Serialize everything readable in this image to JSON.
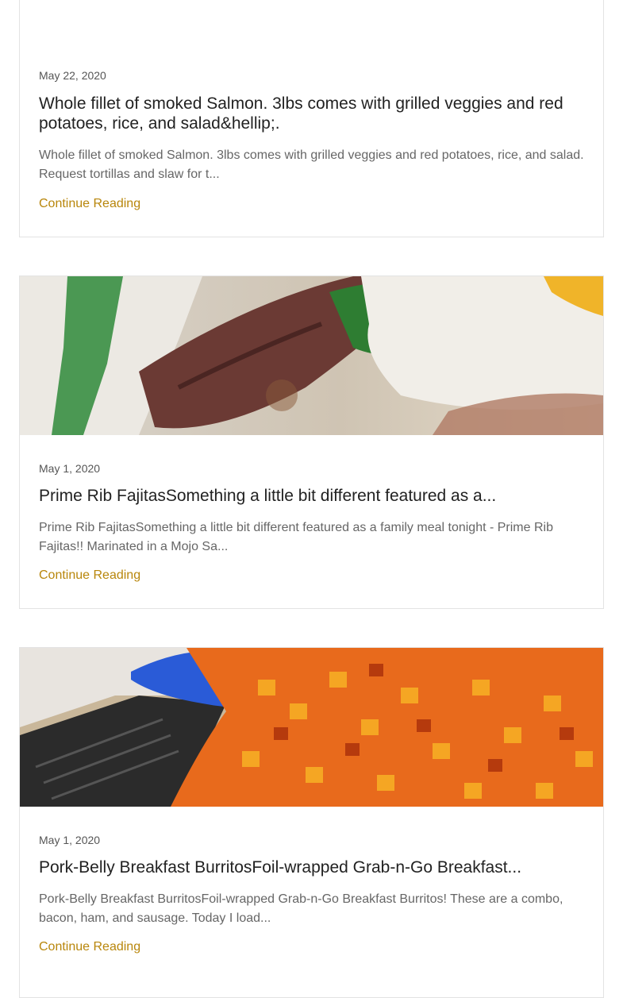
{
  "posts": [
    {
      "date": "May 22, 2020",
      "title": "Whole fillet of smoked Salmon. 3lbs comes with grilled veggies and red potatoes, rice, and salad&hellip;.",
      "excerpt": "Whole fillet of smoked Salmon. 3lbs comes with grilled veggies and red potatoes, rice, and salad. Request tortillas and slaw for t...",
      "link": "Continue Reading"
    },
    {
      "date": "May 1, 2020",
      "title": "Prime Rib FajitasSomething a little bit different featured as a...",
      "excerpt": "Prime Rib FajitasSomething a little bit different featured as a family meal tonight - Prime Rib Fajitas!! Marinated in a Mojo Sa...",
      "link": "Continue Reading"
    },
    {
      "date": "May 1, 2020",
      "title": "Pork-Belly Breakfast BurritosFoil-wrapped Grab-n-Go Breakfast...",
      "excerpt": "Pork-Belly Breakfast BurritosFoil-wrapped Grab-n-Go Breakfast Burritos! These are a combo, bacon, ham, and sausage. Today I load...",
      "link": "Continue Reading"
    }
  ],
  "colors": {
    "link": "#b8860b",
    "border": "#e3e3e3"
  }
}
